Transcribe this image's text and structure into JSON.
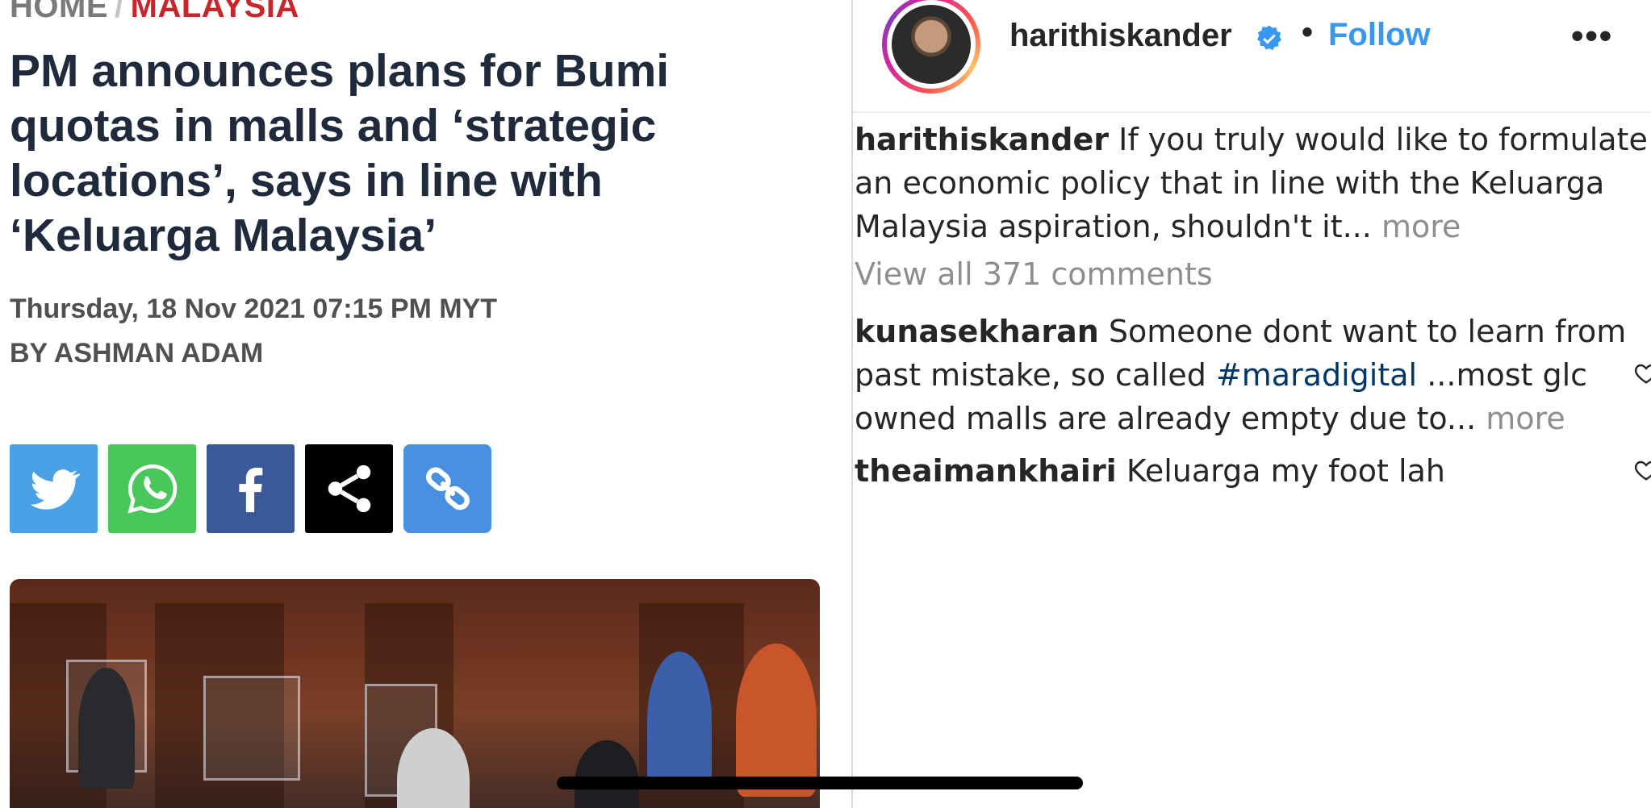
{
  "article": {
    "breadcrumb": {
      "home": "HOME",
      "separator": "/",
      "section": "MALAYSIA"
    },
    "headline": "PM announces plans for Bumi quotas in malls and ‘strategic locations’, says in line with ‘Keluarga Malaysia’",
    "date": "Thursday, 18 Nov 2021 07:15 PM MYT",
    "author": "BY ASHMAN ADAM",
    "share_buttons": [
      "twitter-icon",
      "whatsapp-icon",
      "facebook-icon",
      "share-icon",
      "link-icon"
    ],
    "colors": {
      "headline": "#1f2a3d",
      "section": "#c8262a",
      "twitter": "#4aa1e6",
      "whatsapp": "#49c75a",
      "facebook": "#3b5998",
      "copy": "#4a90e2"
    }
  },
  "instagram": {
    "header": {
      "username": "harithiskander",
      "verified_icon": "verified-badge-icon",
      "dot": "•",
      "follow": "Follow",
      "more": "•••"
    },
    "caption": {
      "username": "harithiskander",
      "text": "If you truly would like to formulate an economic policy that in line with the Keluarga Malaysia aspiration, shouldn't it...",
      "more": "more"
    },
    "view_all": "View all 371 comments",
    "comments": [
      {
        "username": "kunasekharan",
        "text_before": "Someone dont want to learn from past mistake, so called",
        "hashtag": "#maradigital",
        "text_after": "...most glc owned malls are already empty due to...",
        "more": "more"
      },
      {
        "username": "theaimankhairi",
        "text": "Keluarga my foot lah"
      }
    ],
    "colors": {
      "link_blue": "#3897f0",
      "hashtag": "#00376b",
      "muted": "#8e8e8e"
    }
  }
}
